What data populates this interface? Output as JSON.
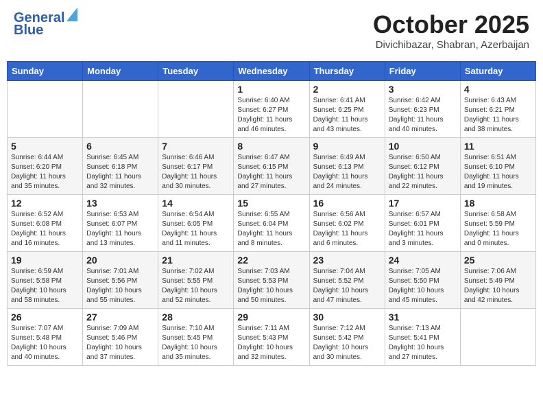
{
  "header": {
    "logo_line1": "General",
    "logo_line2": "Blue",
    "month_title": "October 2025",
    "location": "Divichibazar, Shabran, Azerbaijan"
  },
  "weekdays": [
    "Sunday",
    "Monday",
    "Tuesday",
    "Wednesday",
    "Thursday",
    "Friday",
    "Saturday"
  ],
  "weeks": [
    [
      {
        "day": "",
        "sunrise": "",
        "sunset": "",
        "daylight": ""
      },
      {
        "day": "",
        "sunrise": "",
        "sunset": "",
        "daylight": ""
      },
      {
        "day": "",
        "sunrise": "",
        "sunset": "",
        "daylight": ""
      },
      {
        "day": "1",
        "sunrise": "Sunrise: 6:40 AM",
        "sunset": "Sunset: 6:27 PM",
        "daylight": "Daylight: 11 hours and 46 minutes."
      },
      {
        "day": "2",
        "sunrise": "Sunrise: 6:41 AM",
        "sunset": "Sunset: 6:25 PM",
        "daylight": "Daylight: 11 hours and 43 minutes."
      },
      {
        "day": "3",
        "sunrise": "Sunrise: 6:42 AM",
        "sunset": "Sunset: 6:23 PM",
        "daylight": "Daylight: 11 hours and 40 minutes."
      },
      {
        "day": "4",
        "sunrise": "Sunrise: 6:43 AM",
        "sunset": "Sunset: 6:21 PM",
        "daylight": "Daylight: 11 hours and 38 minutes."
      }
    ],
    [
      {
        "day": "5",
        "sunrise": "Sunrise: 6:44 AM",
        "sunset": "Sunset: 6:20 PM",
        "daylight": "Daylight: 11 hours and 35 minutes."
      },
      {
        "day": "6",
        "sunrise": "Sunrise: 6:45 AM",
        "sunset": "Sunset: 6:18 PM",
        "daylight": "Daylight: 11 hours and 32 minutes."
      },
      {
        "day": "7",
        "sunrise": "Sunrise: 6:46 AM",
        "sunset": "Sunset: 6:17 PM",
        "daylight": "Daylight: 11 hours and 30 minutes."
      },
      {
        "day": "8",
        "sunrise": "Sunrise: 6:47 AM",
        "sunset": "Sunset: 6:15 PM",
        "daylight": "Daylight: 11 hours and 27 minutes."
      },
      {
        "day": "9",
        "sunrise": "Sunrise: 6:49 AM",
        "sunset": "Sunset: 6:13 PM",
        "daylight": "Daylight: 11 hours and 24 minutes."
      },
      {
        "day": "10",
        "sunrise": "Sunrise: 6:50 AM",
        "sunset": "Sunset: 6:12 PM",
        "daylight": "Daylight: 11 hours and 22 minutes."
      },
      {
        "day": "11",
        "sunrise": "Sunrise: 6:51 AM",
        "sunset": "Sunset: 6:10 PM",
        "daylight": "Daylight: 11 hours and 19 minutes."
      }
    ],
    [
      {
        "day": "12",
        "sunrise": "Sunrise: 6:52 AM",
        "sunset": "Sunset: 6:08 PM",
        "daylight": "Daylight: 11 hours and 16 minutes."
      },
      {
        "day": "13",
        "sunrise": "Sunrise: 6:53 AM",
        "sunset": "Sunset: 6:07 PM",
        "daylight": "Daylight: 11 hours and 13 minutes."
      },
      {
        "day": "14",
        "sunrise": "Sunrise: 6:54 AM",
        "sunset": "Sunset: 6:05 PM",
        "daylight": "Daylight: 11 hours and 11 minutes."
      },
      {
        "day": "15",
        "sunrise": "Sunrise: 6:55 AM",
        "sunset": "Sunset: 6:04 PM",
        "daylight": "Daylight: 11 hours and 8 minutes."
      },
      {
        "day": "16",
        "sunrise": "Sunrise: 6:56 AM",
        "sunset": "Sunset: 6:02 PM",
        "daylight": "Daylight: 11 hours and 6 minutes."
      },
      {
        "day": "17",
        "sunrise": "Sunrise: 6:57 AM",
        "sunset": "Sunset: 6:01 PM",
        "daylight": "Daylight: 11 hours and 3 minutes."
      },
      {
        "day": "18",
        "sunrise": "Sunrise: 6:58 AM",
        "sunset": "Sunset: 5:59 PM",
        "daylight": "Daylight: 11 hours and 0 minutes."
      }
    ],
    [
      {
        "day": "19",
        "sunrise": "Sunrise: 6:59 AM",
        "sunset": "Sunset: 5:58 PM",
        "daylight": "Daylight: 10 hours and 58 minutes."
      },
      {
        "day": "20",
        "sunrise": "Sunrise: 7:01 AM",
        "sunset": "Sunset: 5:56 PM",
        "daylight": "Daylight: 10 hours and 55 minutes."
      },
      {
        "day": "21",
        "sunrise": "Sunrise: 7:02 AM",
        "sunset": "Sunset: 5:55 PM",
        "daylight": "Daylight: 10 hours and 52 minutes."
      },
      {
        "day": "22",
        "sunrise": "Sunrise: 7:03 AM",
        "sunset": "Sunset: 5:53 PM",
        "daylight": "Daylight: 10 hours and 50 minutes."
      },
      {
        "day": "23",
        "sunrise": "Sunrise: 7:04 AM",
        "sunset": "Sunset: 5:52 PM",
        "daylight": "Daylight: 10 hours and 47 minutes."
      },
      {
        "day": "24",
        "sunrise": "Sunrise: 7:05 AM",
        "sunset": "Sunset: 5:50 PM",
        "daylight": "Daylight: 10 hours and 45 minutes."
      },
      {
        "day": "25",
        "sunrise": "Sunrise: 7:06 AM",
        "sunset": "Sunset: 5:49 PM",
        "daylight": "Daylight: 10 hours and 42 minutes."
      }
    ],
    [
      {
        "day": "26",
        "sunrise": "Sunrise: 7:07 AM",
        "sunset": "Sunset: 5:48 PM",
        "daylight": "Daylight: 10 hours and 40 minutes."
      },
      {
        "day": "27",
        "sunrise": "Sunrise: 7:09 AM",
        "sunset": "Sunset: 5:46 PM",
        "daylight": "Daylight: 10 hours and 37 minutes."
      },
      {
        "day": "28",
        "sunrise": "Sunrise: 7:10 AM",
        "sunset": "Sunset: 5:45 PM",
        "daylight": "Daylight: 10 hours and 35 minutes."
      },
      {
        "day": "29",
        "sunrise": "Sunrise: 7:11 AM",
        "sunset": "Sunset: 5:43 PM",
        "daylight": "Daylight: 10 hours and 32 minutes."
      },
      {
        "day": "30",
        "sunrise": "Sunrise: 7:12 AM",
        "sunset": "Sunset: 5:42 PM",
        "daylight": "Daylight: 10 hours and 30 minutes."
      },
      {
        "day": "31",
        "sunrise": "Sunrise: 7:13 AM",
        "sunset": "Sunset: 5:41 PM",
        "daylight": "Daylight: 10 hours and 27 minutes."
      },
      {
        "day": "",
        "sunrise": "",
        "sunset": "",
        "daylight": ""
      }
    ]
  ]
}
